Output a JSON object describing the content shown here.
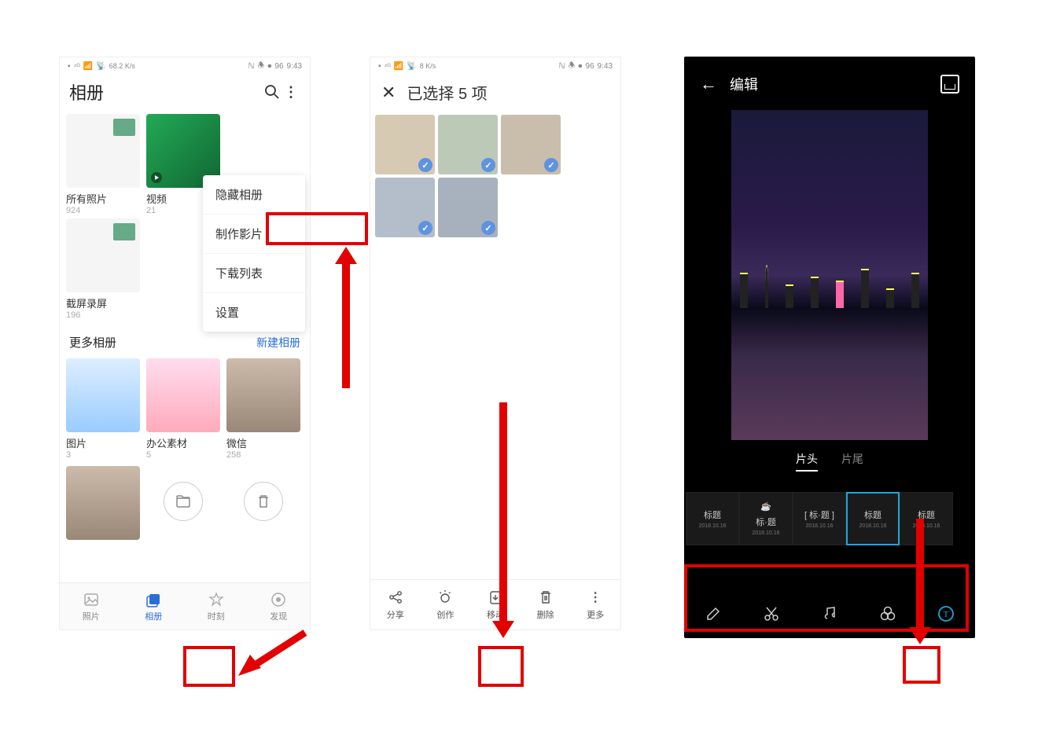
{
  "status": {
    "net": "68.2 K/s",
    "net2": "8 K/s",
    "time": "9:43",
    "battery": "96"
  },
  "p1": {
    "title": "相册",
    "albums": [
      {
        "label": "所有照片",
        "count": "924"
      },
      {
        "label": "视频",
        "count": "21"
      },
      {
        "label": "截屏录屏",
        "count": "196"
      }
    ],
    "menu": {
      "hide": "隐藏相册",
      "make": "制作影片",
      "download": "下载列表",
      "settings": "设置"
    },
    "more_title": "更多相册",
    "new_album": "新建相册",
    "more": [
      {
        "label": "图片",
        "count": "3"
      },
      {
        "label": "办公素材",
        "count": "5"
      },
      {
        "label": "微信",
        "count": "258"
      }
    ],
    "nav": {
      "photos": "照片",
      "albums": "相册",
      "moments": "时刻",
      "discover": "发现"
    }
  },
  "p2": {
    "sel_title": "已选择 5 项",
    "actions": {
      "share": "分享",
      "create": "创作",
      "move": "移动",
      "delete": "删除",
      "more": "更多"
    }
  },
  "p3": {
    "title": "编辑",
    "tab_head": "片头",
    "tab_tail": "片尾",
    "styles": [
      {
        "t": "标题",
        "d": "2018.10.16"
      },
      {
        "t": "标·题",
        "d": "2018.10.16"
      },
      {
        "t": "[ 标·题 ]",
        "d": "2018.10.16"
      },
      {
        "t": "标题",
        "d": "2018.10.16"
      },
      {
        "t": "标题",
        "d": "2018.10.16"
      }
    ]
  }
}
